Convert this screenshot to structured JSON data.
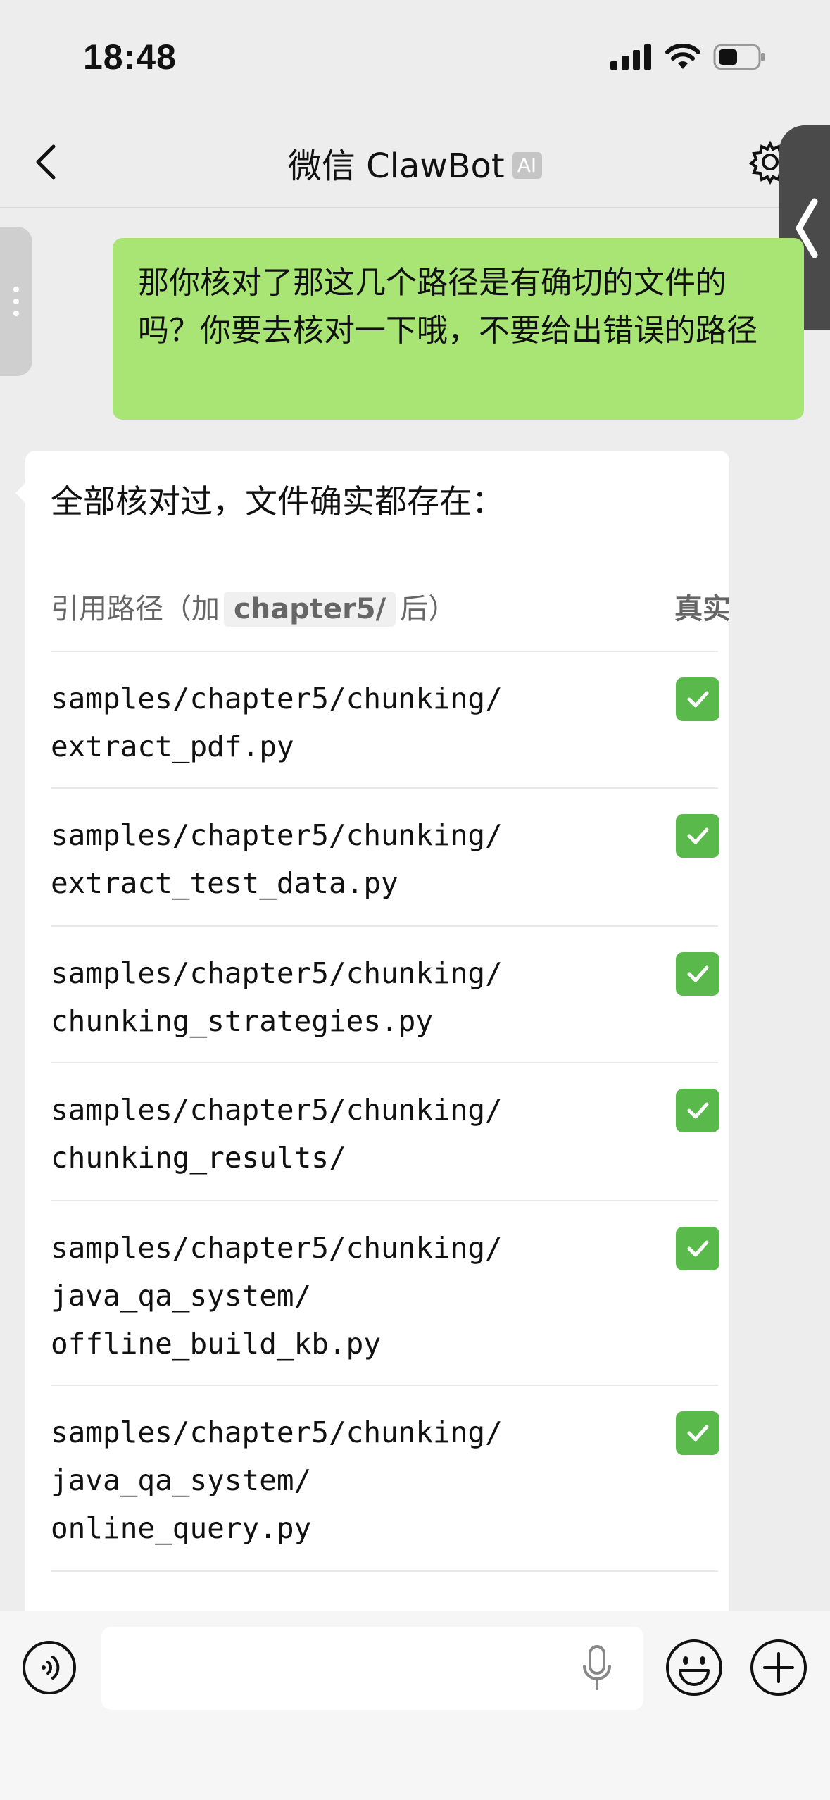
{
  "status": {
    "time": "18:48"
  },
  "nav": {
    "title": "微信 ClawBot",
    "badge": "AI"
  },
  "messages": {
    "user": "那你核对了那这几个路径是有确切的文件的吗？你要去核对一下哦，不要给出错误的路径",
    "bot_intro": "全部核对过，文件确实都存在："
  },
  "table": {
    "header_prefix": "引用路径（加",
    "header_chip": "chapter5/",
    "header_suffix": "后）",
    "header_col2": "真实",
    "rows": [
      {
        "path": "samples/chapter5/chunking/\nextract_pdf.py",
        "status": "✅"
      },
      {
        "path": "samples/chapter5/chunking/\nextract_test_data.py",
        "status": "✅"
      },
      {
        "path": "samples/chapter5/chunking/\nchunking_strategies.py",
        "status": "✅"
      },
      {
        "path": "samples/chapter5/chunking/\nchunking_results/",
        "status": "✅"
      },
      {
        "path": "samples/chapter5/chunking/\njava_qa_system/\noffline_build_kb.py",
        "status": "✅"
      },
      {
        "path": "samples/chapter5/chunking/\njava_qa_system/\nonline_query.py",
        "status": "✅"
      }
    ]
  },
  "input": {
    "placeholder": ""
  },
  "colors": {
    "user_bubble": "#a8e574",
    "check": "#59b94a",
    "background": "#ededed"
  },
  "icons": [
    "back-icon",
    "gear-icon",
    "voice-icon",
    "microphone-icon",
    "emoji-icon",
    "plus-icon",
    "checkmark-icon",
    "signal-icon",
    "wifi-icon",
    "battery-icon"
  ]
}
